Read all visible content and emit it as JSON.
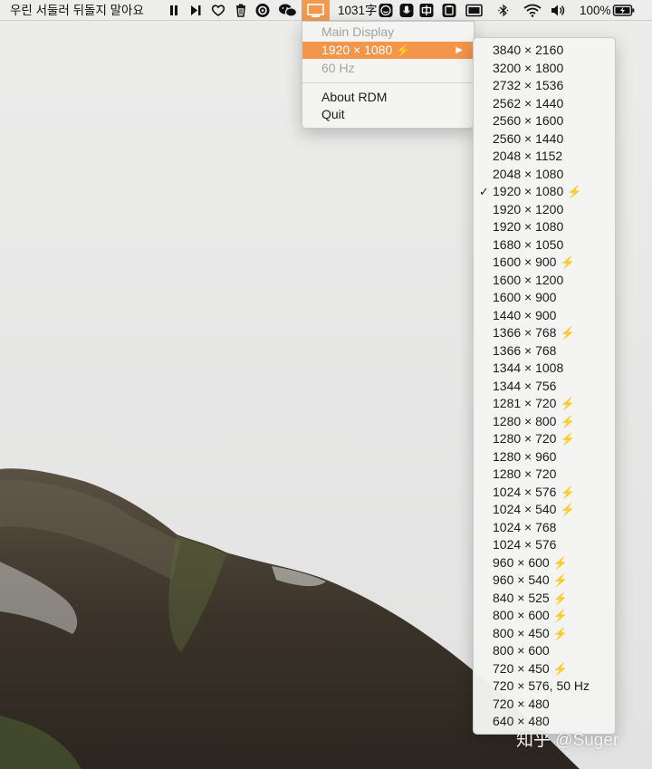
{
  "menubar": {
    "now_playing": "우린 서둘러 뒤돌지 말아요",
    "word_count": "1031字",
    "battery_percent": "100%",
    "icons": [
      "pause-icon",
      "next-track-icon",
      "heart-icon",
      "trash-icon",
      "netease-music-icon",
      "wechat-icon",
      "display-icon",
      "emoji-icon",
      "microphone-icon",
      "chinese-input-icon",
      "clipboard-icon",
      "screen-icon",
      "bluetooth-icon",
      "wifi-icon",
      "volume-icon",
      "battery-charging-icon"
    ]
  },
  "rdm_menu": {
    "display_name": "Main Display",
    "current_resolution": "1920 × 1080",
    "current_resolution_hidpi": true,
    "refresh_rate": "60 Hz",
    "about": "About RDM",
    "quit": "Quit"
  },
  "resolution_menu": {
    "items": [
      {
        "label": "3840 × 2160",
        "hidpi": false,
        "checked": false
      },
      {
        "label": "3200 × 1800",
        "hidpi": false,
        "checked": false
      },
      {
        "label": "2732 × 1536",
        "hidpi": false,
        "checked": false
      },
      {
        "label": "2562 × 1440",
        "hidpi": false,
        "checked": false
      },
      {
        "label": "2560 × 1600",
        "hidpi": false,
        "checked": false
      },
      {
        "label": "2560 × 1440",
        "hidpi": false,
        "checked": false
      },
      {
        "label": "2048 × 1152",
        "hidpi": false,
        "checked": false
      },
      {
        "label": "2048 × 1080",
        "hidpi": false,
        "checked": false
      },
      {
        "label": "1920 × 1080",
        "hidpi": true,
        "checked": true
      },
      {
        "label": "1920 × 1200",
        "hidpi": false,
        "checked": false
      },
      {
        "label": "1920 × 1080",
        "hidpi": false,
        "checked": false
      },
      {
        "label": "1680 × 1050",
        "hidpi": false,
        "checked": false
      },
      {
        "label": "1600 × 900",
        "hidpi": true,
        "checked": false
      },
      {
        "label": "1600 × 1200",
        "hidpi": false,
        "checked": false
      },
      {
        "label": "1600 × 900",
        "hidpi": false,
        "checked": false
      },
      {
        "label": "1440 × 900",
        "hidpi": false,
        "checked": false
      },
      {
        "label": "1366 × 768",
        "hidpi": true,
        "checked": false
      },
      {
        "label": "1366 × 768",
        "hidpi": false,
        "checked": false
      },
      {
        "label": "1344 × 1008",
        "hidpi": false,
        "checked": false
      },
      {
        "label": "1344 × 756",
        "hidpi": false,
        "checked": false
      },
      {
        "label": "1281 × 720",
        "hidpi": true,
        "checked": false
      },
      {
        "label": "1280 × 800",
        "hidpi": true,
        "checked": false
      },
      {
        "label": "1280 × 720",
        "hidpi": true,
        "checked": false
      },
      {
        "label": "1280 × 960",
        "hidpi": false,
        "checked": false
      },
      {
        "label": "1280 × 720",
        "hidpi": false,
        "checked": false
      },
      {
        "label": "1024 × 576",
        "hidpi": true,
        "checked": false
      },
      {
        "label": "1024 × 540",
        "hidpi": true,
        "checked": false
      },
      {
        "label": "1024 × 768",
        "hidpi": false,
        "checked": false
      },
      {
        "label": "1024 × 576",
        "hidpi": false,
        "checked": false
      },
      {
        "label": "960 × 600",
        "hidpi": true,
        "checked": false
      },
      {
        "label": "960 × 540",
        "hidpi": true,
        "checked": false
      },
      {
        "label": "840 × 525",
        "hidpi": true,
        "checked": false
      },
      {
        "label": "800 × 600",
        "hidpi": true,
        "checked": false
      },
      {
        "label": "800 × 450",
        "hidpi": true,
        "checked": false
      },
      {
        "label": "800 × 600",
        "hidpi": false,
        "checked": false
      },
      {
        "label": "720 × 450",
        "hidpi": true,
        "checked": false
      },
      {
        "label": "720 × 576, 50 Hz",
        "hidpi": false,
        "checked": false
      },
      {
        "label": "720 × 480",
        "hidpi": false,
        "checked": false
      },
      {
        "label": "640 × 480",
        "hidpi": false,
        "checked": false
      }
    ],
    "check_glyph": "✓",
    "hidpi_glyph": "⚡"
  },
  "watermark": "知乎 @Suger",
  "colors": {
    "accent": "#f3954a",
    "bolt": "#f2a22b",
    "sky": "#e6e7e6",
    "mountain": "#3d352c"
  }
}
